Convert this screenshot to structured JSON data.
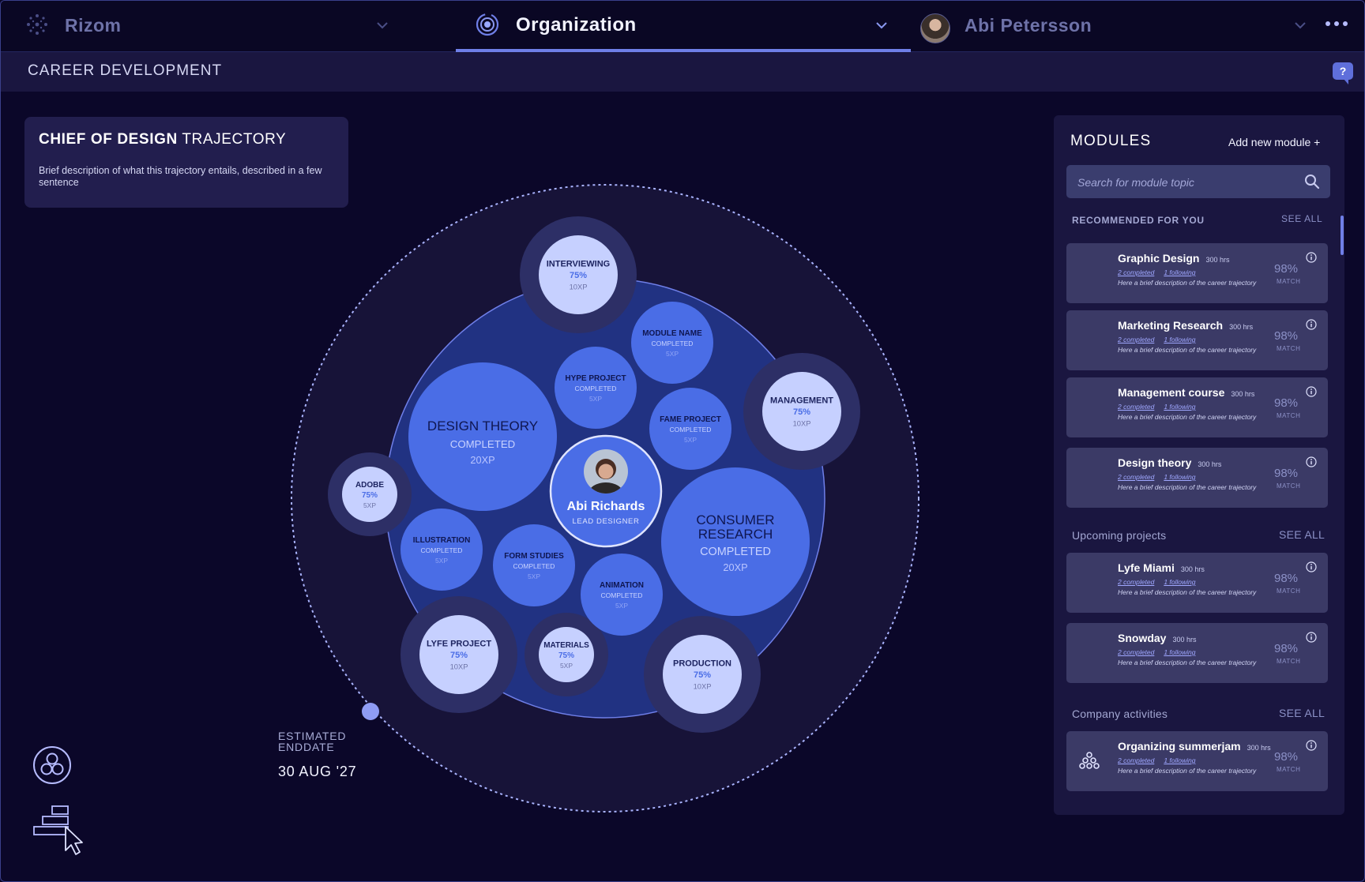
{
  "topbar": {
    "app_name": "Rizom",
    "org_name": "Organization",
    "user_name": "Abi Petersson"
  },
  "subheader": {
    "title": "CAREER DEVELOPMENT",
    "help": "?"
  },
  "trajectory": {
    "title_bold": "CHIEF OF DESIGN",
    "title_rest": "TRAJECTORY",
    "description": "Brief description of what this trajectory entails, described in a few sentence"
  },
  "center": {
    "name": "Abi Richards",
    "role": "LEAD DESIGNER"
  },
  "bubbles": [
    {
      "id": "interviewing",
      "line1": "INTERVIEWING",
      "status": "75%",
      "xp": "10XP",
      "style": "progress"
    },
    {
      "id": "module-name",
      "line1": "MODULE NAME",
      "status": "COMPLETED",
      "xp": "5XP",
      "style": "done"
    },
    {
      "id": "hype-project",
      "line1": "HYPE PROJECT",
      "status": "COMPLETED",
      "xp": "5XP",
      "style": "done"
    },
    {
      "id": "design-theory",
      "line1": "DESIGN THEORY",
      "status": "COMPLETED",
      "xp": "20XP",
      "style": "done"
    },
    {
      "id": "fame-project",
      "line1": "FAME PROJECT",
      "status": "COMPLETED",
      "xp": "5XP",
      "style": "done"
    },
    {
      "id": "management",
      "line1": "MANAGEMENT",
      "status": "75%",
      "xp": "10XP",
      "style": "progress"
    },
    {
      "id": "adobe",
      "line1": "ADOBE",
      "status": "75%",
      "xp": "5XP",
      "style": "progress"
    },
    {
      "id": "illustration",
      "line1": "ILLUSTRATION",
      "status": "COMPLETED",
      "xp": "5XP",
      "style": "done"
    },
    {
      "id": "form-studies",
      "line1": "FORM STUDIES",
      "status": "COMPLETED",
      "xp": "5XP",
      "style": "done"
    },
    {
      "id": "consumer-research",
      "line1": "CONSUMER",
      "line2": "RESEARCH",
      "status": "COMPLETED",
      "xp": "20XP",
      "style": "done"
    },
    {
      "id": "animation",
      "line1": "ANIMATION",
      "status": "COMPLETED",
      "xp": "5XP",
      "style": "done"
    },
    {
      "id": "lyfe-project",
      "line1": "LYFE PROJECT",
      "status": "75%",
      "xp": "10XP",
      "style": "progress"
    },
    {
      "id": "materials",
      "line1": "MATERIALS",
      "status": "75%",
      "xp": "5XP",
      "style": "progress"
    },
    {
      "id": "production",
      "line1": "PRODUCTION",
      "status": "75%",
      "xp": "10XP",
      "style": "progress"
    }
  ],
  "enddate": {
    "label_line1": "ESTIMATED",
    "label_line2": "ENDDATE",
    "date": "30 AUG '27"
  },
  "modules": {
    "title": "MODULES",
    "add_label": "Add new module +",
    "search_placeholder": "Search for module topic",
    "sections": [
      {
        "label": "RECOMMENDED FOR YOU",
        "see_all": "SEE ALL"
      },
      {
        "label": "Upcoming projects",
        "see_all": "SEE ALL"
      },
      {
        "label": "Company activities",
        "see_all": "SEE ALL"
      }
    ],
    "cards": [
      {
        "title": "Graphic Design",
        "hrs": "300 hrs",
        "completed": "2 completed",
        "following": "1 following",
        "desc": "Here a brief description of the career trajectory",
        "pct": "98%",
        "match": "MATCH"
      },
      {
        "title": "Marketing Research",
        "hrs": "300 hrs",
        "completed": "2 completed",
        "following": "1 following",
        "desc": "Here a brief description of the career trajectory",
        "pct": "98%",
        "match": "MATCH"
      },
      {
        "title": "Management course",
        "hrs": "300 hrs",
        "completed": "2 completed",
        "following": "1 following",
        "desc": "Here a brief description of the career trajectory",
        "pct": "98%",
        "match": "MATCH"
      },
      {
        "title": "Design theory",
        "hrs": "300 hrs",
        "completed": "2 completed",
        "following": "1 following",
        "desc": "Here a brief description of the career trajectory",
        "pct": "98%",
        "match": "MATCH"
      },
      {
        "title": "Lyfe Miami",
        "hrs": "300 hrs",
        "completed": "2 completed",
        "following": "1 following",
        "desc": "Here a brief description of the career trajectory",
        "pct": "98%",
        "match": "MATCH"
      },
      {
        "title": "Snowday",
        "hrs": "300 hrs",
        "completed": "2 completed",
        "following": "1 following",
        "desc": "Here a brief description of the career trajectory",
        "pct": "98%",
        "match": "MATCH"
      },
      {
        "title": "Organizing summerjam",
        "hrs": "300 hrs",
        "completed": "2 completed",
        "following": "1 following",
        "desc": "Here a brief description of the career trajectory",
        "pct": "98%",
        "match": "MATCH"
      }
    ]
  },
  "colors": {
    "background": "#0b0729",
    "accent": "#6f7fe8",
    "bubble_done": "#4a6de6",
    "bubble_progress": "#c6d0ff",
    "panel": "#1a1640",
    "card": "#3b3a66"
  }
}
